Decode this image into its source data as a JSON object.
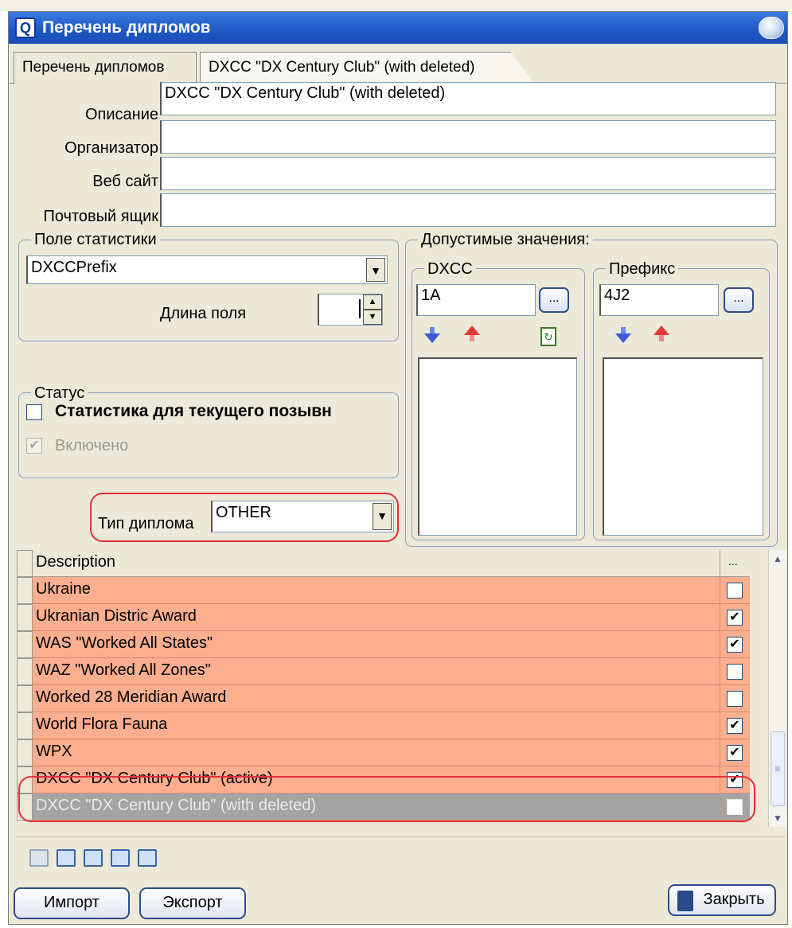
{
  "window": {
    "title": "Перечень дипломов"
  },
  "tabs": [
    {
      "label": "Перечень дипломов"
    },
    {
      "label": "DXCC \"DX Century Club\" (with deleted)"
    }
  ],
  "form": {
    "description_label": "Описание",
    "description_value": "DXCC \"DX Century Club\" (with deleted)",
    "organizer_label": "Организатор",
    "organizer_value": "",
    "website_label": "Веб сайт",
    "website_value": "",
    "mailbox_label": "Почтовый ящик",
    "mailbox_value": ""
  },
  "stat_field": {
    "group_label": "Поле статистики",
    "selected": "DXCCPrefix",
    "length_label": "Длина поля",
    "length_value": ""
  },
  "status": {
    "group_label": "Статус",
    "current_call_label": "Статистика для текущего позывн",
    "current_call_checked": false,
    "enabled_label": "Включено",
    "enabled_checked": true
  },
  "award_type": {
    "label": "Тип диплома",
    "selected": "OTHER"
  },
  "allowed": {
    "group_label": "Допустимые значения:",
    "dxcc": {
      "label": "DXCC",
      "value": "1A",
      "button": "..."
    },
    "prefix": {
      "label": "Префикс",
      "value": "4J2",
      "button": "..."
    }
  },
  "grid": {
    "header": {
      "description": "Description",
      "check": "..."
    },
    "rows": [
      {
        "description": "Ukraine",
        "checked": false
      },
      {
        "description": "Ukranian Distric Award",
        "checked": true
      },
      {
        "description": "WAS \"Worked All States\"",
        "checked": true
      },
      {
        "description": "WAZ \"Worked All Zones\"",
        "checked": false
      },
      {
        "description": "Worked 28 Meridian Award",
        "checked": false
      },
      {
        "description": "World Flora Fauna",
        "checked": true
      },
      {
        "description": "WPX",
        "checked": true
      },
      {
        "description": "DXCC \"DX Century Club\" (active)",
        "checked": true
      },
      {
        "description": "DXCC \"DX Century Club\" (with deleted)",
        "checked": false,
        "selected": true
      }
    ]
  },
  "buttons": {
    "import": "Импорт",
    "export": "Экспорт",
    "close": "Закрыть"
  },
  "colors": {
    "row_bg": "#fcae8e",
    "selected_bg": "#a4a4a4",
    "highlight_ring": "#e0303c",
    "titlebar": "#1f58c4"
  }
}
